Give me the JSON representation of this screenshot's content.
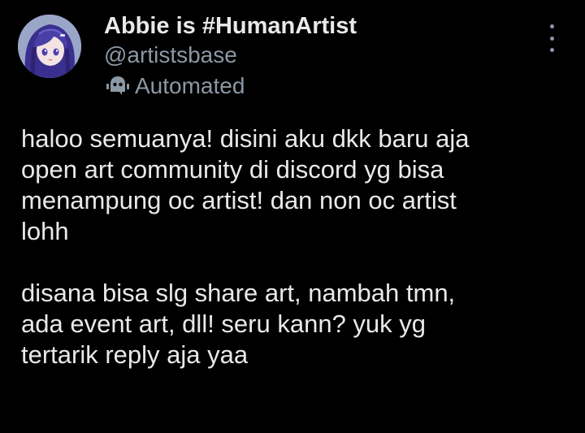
{
  "author": {
    "display_name": "Abbie is #HumanArtist",
    "handle": "@artistsbase",
    "badge_icon": "robot-icon",
    "badge_label": "Automated",
    "avatar_colors": {
      "background": "#9aa6c8",
      "hair": "#3a2f8f",
      "hair_light": "#6b63c9",
      "skin": "#f4e3e3"
    }
  },
  "menu": {
    "icon": "more-vertical-icon"
  },
  "tweet": {
    "paragraphs": [
      {
        "lines": [
          "haloo semuanya! disini aku dkk baru aja",
          "open art community di discord yg bisa",
          "menampung oc artist! dan non oc artist",
          "lohh"
        ]
      },
      {
        "lines": [
          "disana bisa slg share art, nambah tmn,",
          "ada event art, dll! seru kann? yuk yg",
          "tertarik reply aja yaa"
        ]
      }
    ]
  },
  "colors": {
    "background": "#000000",
    "primary_text": "#e7e9ea",
    "secondary_text": "#8b98a5"
  }
}
